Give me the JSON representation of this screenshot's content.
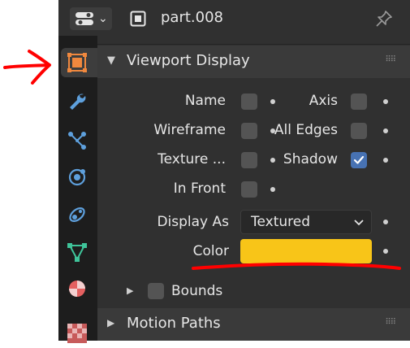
{
  "header": {
    "object_name": "part.008",
    "editor_icon": "properties-editor-icon",
    "pin_icon": "pin-icon"
  },
  "tabs": [
    {
      "name": "object",
      "icon": "object-properties-icon",
      "active": true
    },
    {
      "name": "modifiers",
      "icon": "wrench-icon"
    },
    {
      "name": "particles",
      "icon": "particles-icon"
    },
    {
      "name": "physics",
      "icon": "physics-icon"
    },
    {
      "name": "constraints",
      "icon": "constraints-icon"
    },
    {
      "name": "data",
      "icon": "mesh-data-icon"
    },
    {
      "name": "material",
      "icon": "material-icon"
    },
    {
      "name": "texture",
      "icon": "texture-icon"
    }
  ],
  "viewport_display": {
    "title": "Viewport Display",
    "left_options": [
      {
        "label": "Name",
        "checked": false
      },
      {
        "label": "Wireframe",
        "checked": false
      },
      {
        "label": "Texture ...",
        "checked": false
      },
      {
        "label": "In Front",
        "checked": false
      }
    ],
    "right_options": [
      {
        "label": "Axis",
        "checked": false
      },
      {
        "label": "All Edges",
        "checked": false
      },
      {
        "label": "Shadow",
        "checked": true
      }
    ],
    "display_as": {
      "label": "Display As",
      "value": "Textured"
    },
    "color": {
      "label": "Color",
      "value": "#f8c518"
    },
    "bounds": {
      "label": "Bounds",
      "checked": false
    }
  },
  "motion_paths": {
    "title": "Motion Paths"
  },
  "colors": {
    "accent": "#4772b3",
    "annotation": "#ff0000"
  }
}
